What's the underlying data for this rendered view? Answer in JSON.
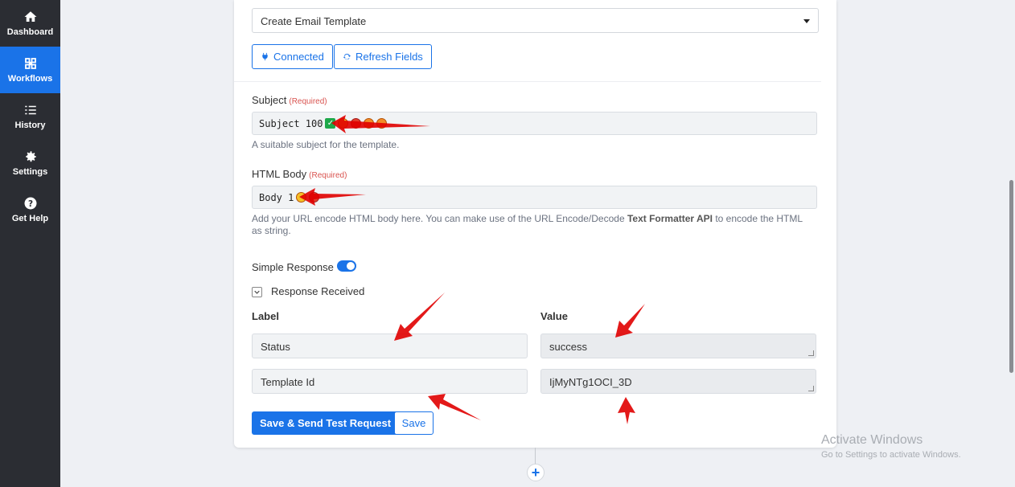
{
  "sidebar": {
    "items": [
      {
        "label": "Dashboard",
        "icon": "home-icon"
      },
      {
        "label": "Workflows",
        "icon": "workflow-icon",
        "active": true
      },
      {
        "label": "History",
        "icon": "list-icon"
      },
      {
        "label": "Settings",
        "icon": "gear-icon"
      },
      {
        "label": "Get Help",
        "icon": "help-icon"
      }
    ]
  },
  "action": {
    "selected": "Create Email Template",
    "connected_label": "Connected",
    "refresh_label": "Refresh Fields"
  },
  "subject": {
    "label": "Subject",
    "required": "(Required)",
    "value": "Subject 100",
    "help": "A suitable subject for the template."
  },
  "html_body": {
    "label": "HTML Body",
    "required": "(Required)",
    "value": "Body 1",
    "help_pre": "Add your URL encode HTML body here. You can make use of the URL Encode/Decode ",
    "help_bold": "Text Formatter API",
    "help_post": " to encode the HTML as string."
  },
  "response": {
    "simple_label": "Simple Response",
    "simple_enabled": true,
    "received_label": "Response Received",
    "label_header": "Label",
    "value_header": "Value",
    "rows": [
      {
        "label": "Status",
        "value": "success"
      },
      {
        "label": "Template Id",
        "value": "IjMyNTg1OCI_3D"
      }
    ]
  },
  "buttons": {
    "save_send": "Save & Send Test Request",
    "save": "Save"
  },
  "watermark": {
    "title": "Activate Windows",
    "subtitle": "Go to Settings to activate Windows."
  },
  "colors": {
    "accent": "#1a73e8",
    "sidebar": "#2b2d33",
    "required": "#d9534f"
  }
}
